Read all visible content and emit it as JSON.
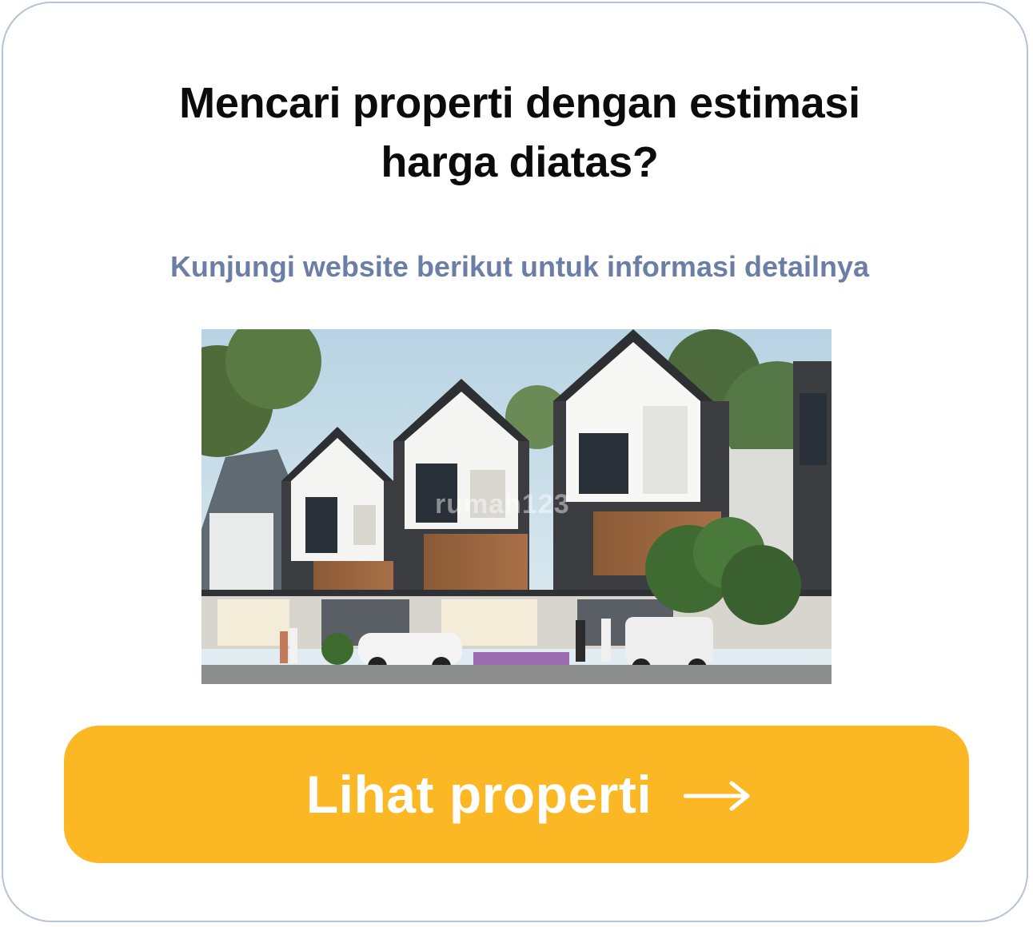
{
  "card": {
    "title_line1": "Mencari properti dengan estimasi",
    "title_line2": "harga diatas?",
    "subtitle": "Kunjungi website berikut untuk informasi detailnya"
  },
  "image": {
    "watermark": "rumah123"
  },
  "cta": {
    "label": "Lihat properti",
    "icon": "arrow-right-icon"
  },
  "colors": {
    "card_border": "#b4c3d8",
    "title": "#0b0b0b",
    "subtitle": "#6b7fa6",
    "button": "#fbb724",
    "button_text": "#ffffff"
  }
}
